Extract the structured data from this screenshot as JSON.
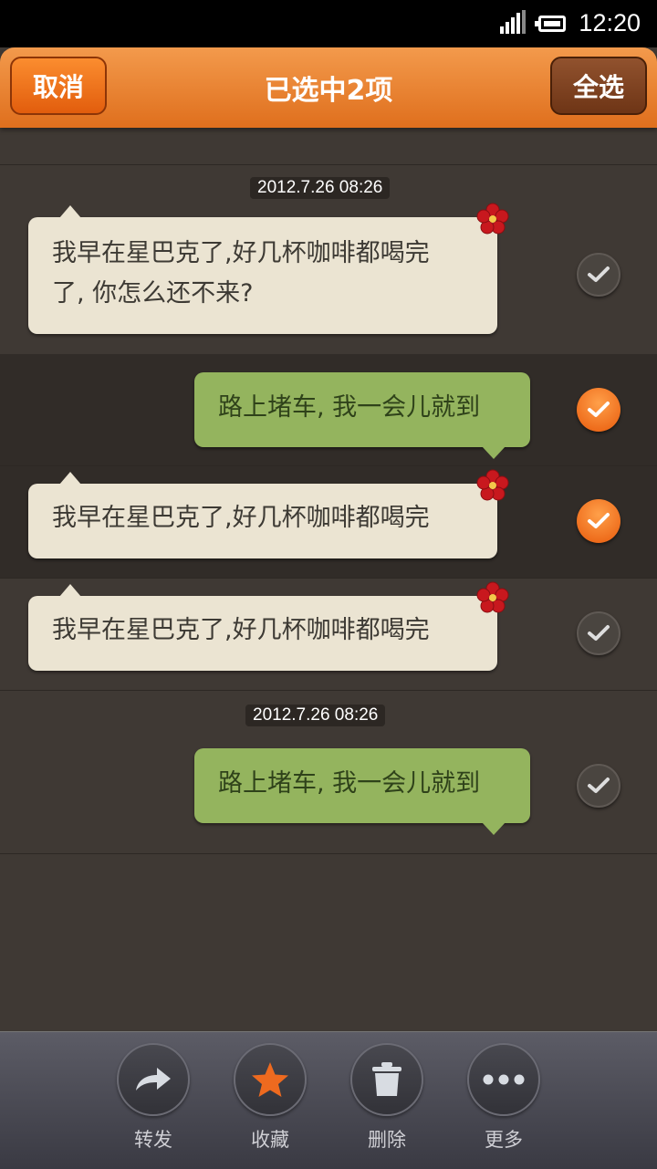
{
  "status_bar": {
    "time": "12:20"
  },
  "header": {
    "cancel_label": "取消",
    "title": "已选中2项",
    "select_all_label": "全选"
  },
  "messages": [
    {
      "timestamp": "2012.7.26  08:26",
      "side": "left",
      "text_lines": [
        "我早在星巴克了,好几杯咖啡都喝完",
        "了, 你怎么还不来?"
      ],
      "selected": false
    },
    {
      "side": "right",
      "text": "路上堵车, 我一会儿就到",
      "selected": true
    },
    {
      "side": "left",
      "text": "我早在星巴克了,好几杯咖啡都喝完",
      "selected": true
    },
    {
      "side": "left",
      "text": "我早在星巴克了,好几杯咖啡都喝完",
      "selected": false
    },
    {
      "timestamp": "2012.7.26  08:26",
      "side": "right",
      "text": "路上堵车, 我一会儿就到",
      "selected": false
    }
  ],
  "toolbar": {
    "items": [
      {
        "label": "转发",
        "icon": "forward-arrow-icon"
      },
      {
        "label": "收藏",
        "icon": "star-icon"
      },
      {
        "label": "删除",
        "icon": "trash-icon"
      },
      {
        "label": "更多",
        "icon": "more-dots-icon"
      }
    ]
  },
  "colors": {
    "header_orange": "#e77a2a",
    "selected_check": "#f27a1f",
    "left_bubble": "#ebe4d2",
    "right_bubble": "#94b45e",
    "background": "#3f3934"
  }
}
